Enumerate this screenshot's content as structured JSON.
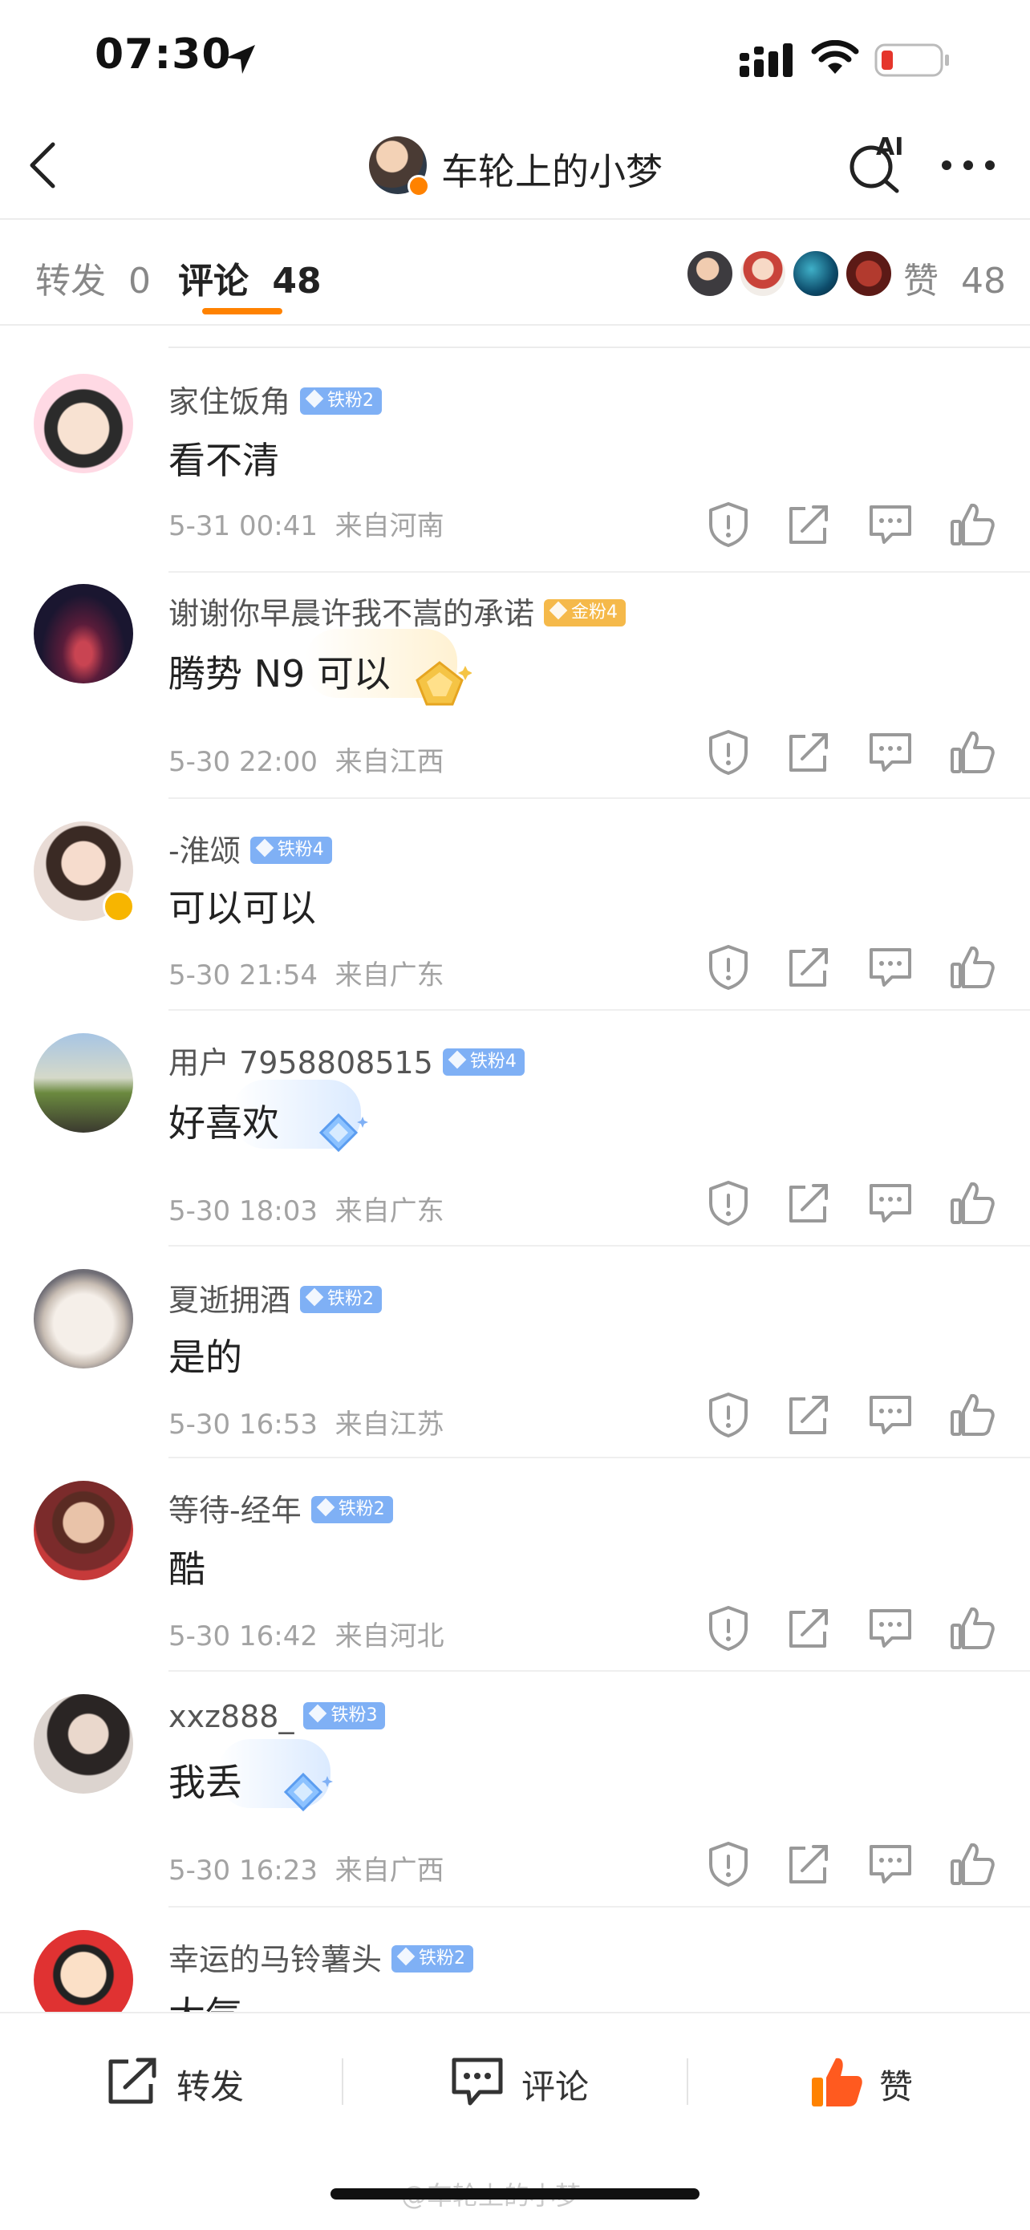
{
  "status_bar": {
    "time": "07:30"
  },
  "header": {
    "title": "车轮上的小梦",
    "ai_label": "AI"
  },
  "tabs": {
    "repost_label": "转发",
    "repost_count": "0",
    "comment_label": "评论",
    "comment_count": "48",
    "like_label": "赞",
    "like_count": "48"
  },
  "comments": [
    {
      "user": "家住饭角",
      "badge": "铁粉2",
      "text": "看不清",
      "time": "5-31 00:41",
      "location": "来自河南"
    },
    {
      "user": "谢谢你早晨许我不嵩的承诺",
      "badge": "金粉4",
      "text": "腾势 N9 可以",
      "time": "5-30 22:00",
      "location": "来自江西"
    },
    {
      "user": "-淮颂",
      "badge": "铁粉4",
      "text": "可以可以",
      "time": "5-30 21:54",
      "location": "来自广东"
    },
    {
      "user": "用户 7958808515",
      "badge": "铁粉4",
      "text": "好喜欢",
      "time": "5-30 18:03",
      "location": "来自广东"
    },
    {
      "user": "夏逝拥酒",
      "badge": "铁粉2",
      "text": "是的",
      "time": "5-30 16:53",
      "location": "来自江苏"
    },
    {
      "user": "等待-经年",
      "badge": "铁粉2",
      "text": "酷",
      "time": "5-30 16:42",
      "location": "来自河北"
    },
    {
      "user": "xxz888_",
      "badge": "铁粉3",
      "text": "我丢",
      "time": "5-30 16:23",
      "location": "来自广西"
    },
    {
      "user": "幸运的马铃薯头",
      "badge": "铁粉2",
      "text": "大气",
      "time": "",
      "location": ""
    }
  ],
  "bottom_bar": {
    "repost": "转发",
    "comment": "评论",
    "like": "赞"
  },
  "watermark": "@车轮上的小梦",
  "colors": {
    "accent": "#ff8200",
    "badge_iron": "#7fb0f5",
    "badge_gold": "#f5b94a",
    "battery_low": "#e5352b"
  }
}
